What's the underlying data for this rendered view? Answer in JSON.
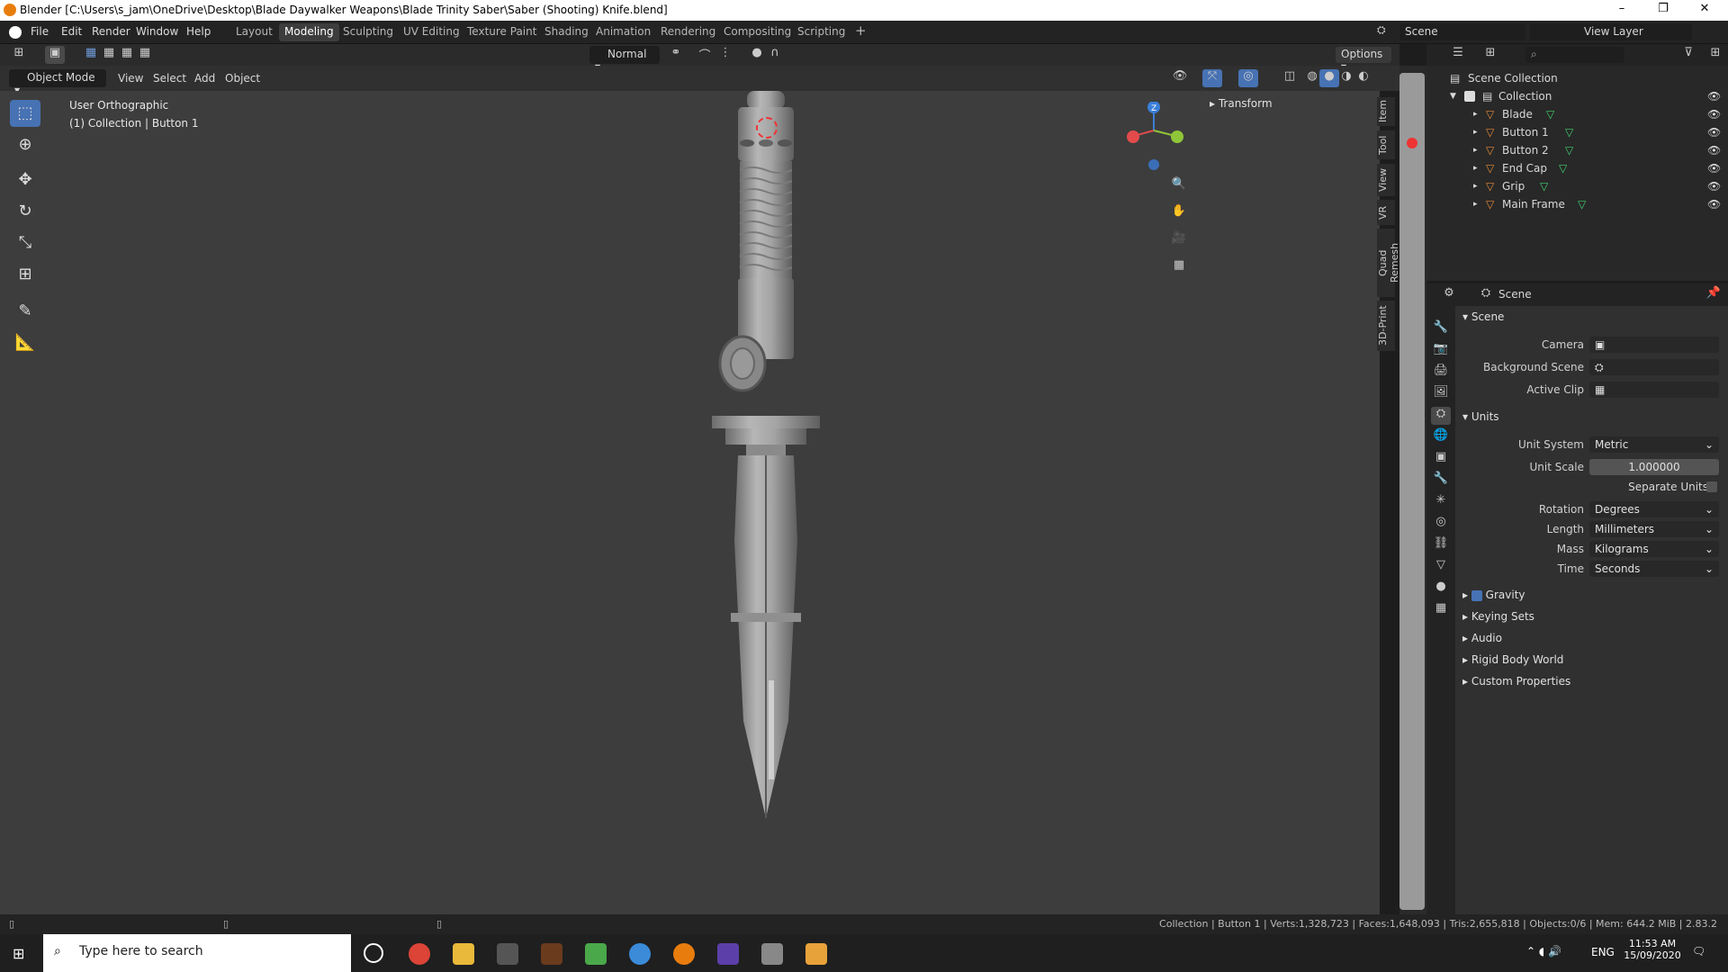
{
  "window": {
    "title": "Blender [C:\\Users\\s_jam\\OneDrive\\Desktop\\Blade Daywalker Weapons\\Blade Trinity Saber\\Saber (Shooting) Knife.blend]",
    "min": "–",
    "restore": "❐",
    "close": "✕"
  },
  "menus": [
    "File",
    "Edit",
    "Render",
    "Window",
    "Help"
  ],
  "workspaces": [
    "Layout",
    "Modeling",
    "Sculpting",
    "UV Editing",
    "Texture Paint",
    "Shading",
    "Animation",
    "Rendering",
    "Compositing",
    "Scripting"
  ],
  "add_tab": "+",
  "scene_field": "Scene",
  "viewlayer_field": "View Layer",
  "toolbar2": {
    "orientation": "Normal",
    "options": "Options"
  },
  "header": {
    "mode": "Object Mode",
    "view": "View",
    "select": "Select",
    "add": "Add",
    "object": "Object"
  },
  "viewport": {
    "line1": "User Orthographic",
    "line2": "(1) Collection | Button 1",
    "transform": "Transform"
  },
  "npanel_tabs": [
    "Item",
    "Tool",
    "View",
    "VR",
    "Quad Remesh",
    "3D-Print"
  ],
  "outliner": {
    "root": "Scene Collection",
    "collection": "Collection",
    "objects": [
      "Blade",
      "Button 1",
      "Button 2",
      "End Cap",
      "Grip",
      "Main Frame"
    ]
  },
  "properties": {
    "header": "Scene",
    "scene_section": "Scene",
    "camera_label": "Camera",
    "bg_label": "Background Scene",
    "clip_label": "Active Clip",
    "units_section": "Units",
    "unit_system_label": "Unit System",
    "unit_system": "Metric",
    "unit_scale_label": "Unit Scale",
    "unit_scale": "1.000000",
    "separate_units": "Separate Units",
    "rotation_label": "Rotation",
    "rotation": "Degrees",
    "length_label": "Length",
    "length": "Millimeters",
    "mass_label": "Mass",
    "mass": "Kilograms",
    "time_label": "Time",
    "time": "Seconds",
    "gravity": "Gravity",
    "keying_sets": "Keying Sets",
    "audio": "Audio",
    "rigid_body": "Rigid Body World",
    "custom_props": "Custom Properties"
  },
  "status": "Collection | Button 1 | Verts:1,328,723 | Faces:1,648,093 | Tris:2,655,818 | Objects:0/6 | Mem: 644.2 MiB | 2.83.2",
  "taskbar": {
    "search": "Type here to search",
    "lang": "ENG",
    "time": "11:53 AM",
    "date": "15/09/2020"
  },
  "colors": {
    "accent": "#4772b3",
    "object_orange": "#e88b3a",
    "mesh_green": "#3fd16f"
  }
}
